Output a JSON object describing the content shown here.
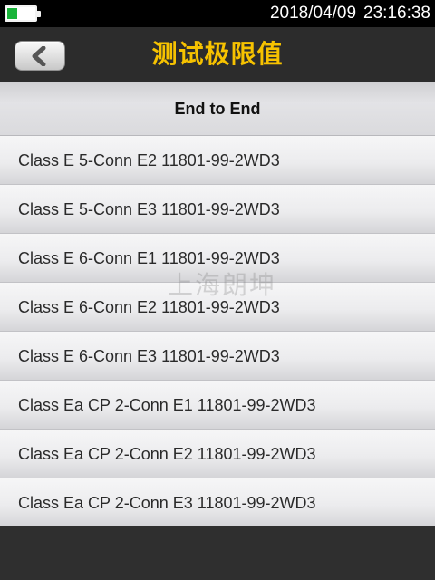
{
  "status": {
    "battery_level": 0.35,
    "battery_color": "#19b43a",
    "date": "2018/04/09",
    "time": "23:16:38"
  },
  "header": {
    "title": "测试极限值",
    "title_color": "#f6c200",
    "back_icon": "chevron-left-icon"
  },
  "list": {
    "group_header": "End to End",
    "items": [
      "Class E 5-Conn E2 11801-99-2WD3",
      "Class E 5-Conn E3 11801-99-2WD3",
      "Class E 6-Conn E1 11801-99-2WD3",
      "Class E 6-Conn E2 11801-99-2WD3",
      "Class E 6-Conn E3 11801-99-2WD3",
      "Class Ea CP 2-Conn E1 11801-99-2WD3",
      "Class Ea CP 2-Conn E2 11801-99-2WD3",
      "Class Ea CP 2-Conn E3 11801-99-2WD3"
    ]
  },
  "watermark": "上海朗坤"
}
